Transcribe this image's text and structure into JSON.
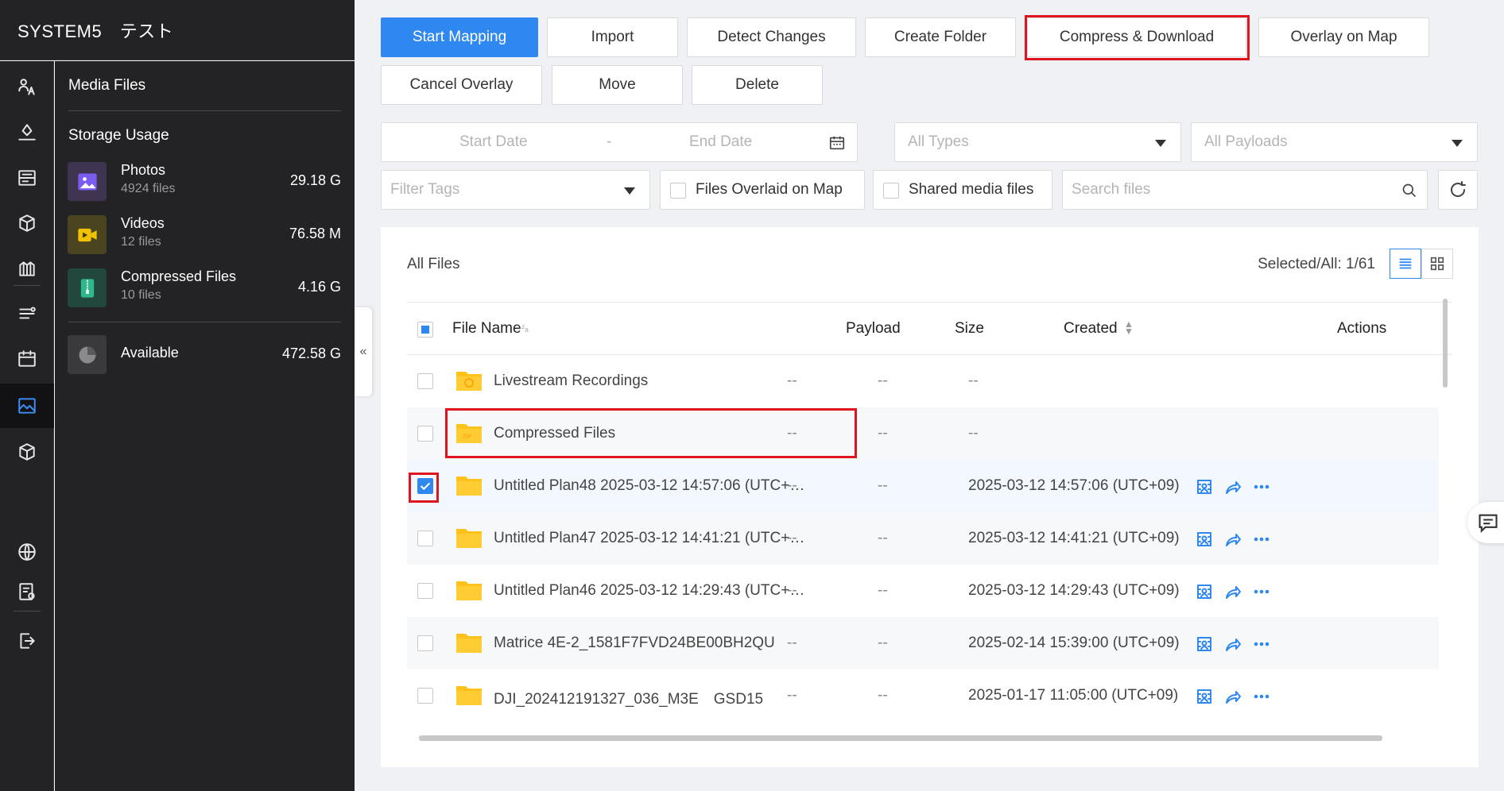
{
  "app": {
    "title": "SYSTEM5　テスト"
  },
  "panel": {
    "title": "Media Files",
    "storage_title": "Storage Usage",
    "items": [
      {
        "name": "Photos",
        "count": "4924 files",
        "size": "29.18 G",
        "color": "#6b4fd8"
      },
      {
        "name": "Videos",
        "count": "12 files",
        "size": "76.58 M",
        "color": "#f2c200"
      },
      {
        "name": "Compressed Files",
        "count": "10 files",
        "size": "4.16 G",
        "color": "#2fb88a"
      }
    ],
    "available": {
      "name": "Available",
      "size": "472.58 G"
    }
  },
  "rail_icons": [
    "team-icon",
    "flight-icon",
    "mission-icon",
    "model-icon",
    "map-layers-icon",
    "fleet-icon",
    "calendar-icon",
    "media-icon",
    "device-icon",
    "globe-icon",
    "settings-icon",
    "logout-icon"
  ],
  "toolbar": {
    "start_mapping": "Start Mapping",
    "import": "Import",
    "detect_changes": "Detect Changes",
    "create_folder": "Create Folder",
    "compress_download": "Compress & Download",
    "overlay_on_map": "Overlay on Map",
    "cancel_overlay": "Cancel Overlay",
    "move": "Move",
    "delete": "Delete"
  },
  "filters": {
    "start_date": "Start Date",
    "date_sep": "-",
    "end_date": "End Date",
    "types": "All Types",
    "payloads": "All Payloads",
    "tags": "Filter Tags",
    "overlaid": "Files Overlaid on Map",
    "shared": "Shared media files",
    "search_placeholder": "Search files"
  },
  "table": {
    "heading": "All Files",
    "selected": "Selected/All: 1/61",
    "columns": [
      "File Name",
      "Payload",
      "Size",
      "Created",
      "Actions"
    ],
    "rows": [
      {
        "name": "Livestream Recordings",
        "payload": "--",
        "size": "--",
        "created": "--",
        "checked": false,
        "folder": "live",
        "actions": false
      },
      {
        "name": "Compressed Files",
        "payload": "--",
        "size": "--",
        "created": "--",
        "checked": false,
        "folder": "zip",
        "actions": false
      },
      {
        "name": "Untitled Plan48 2025-03-12 14:57:06 (UTC+…",
        "payload": "--",
        "size": "--",
        "created": "2025-03-12 14:57:06 (UTC+09)",
        "checked": true,
        "folder": "plain",
        "actions": true
      },
      {
        "name": "Untitled Plan47 2025-03-12 14:41:21 (UTC+…",
        "payload": "--",
        "size": "--",
        "created": "2025-03-12 14:41:21 (UTC+09)",
        "checked": false,
        "folder": "plain",
        "actions": true
      },
      {
        "name": "Untitled Plan46 2025-03-12 14:29:43 (UTC+…",
        "payload": "--",
        "size": "--",
        "created": "2025-03-12 14:29:43 (UTC+09)",
        "checked": false,
        "folder": "plain",
        "actions": true
      },
      {
        "name": "Matrice 4E-2_1581F7FVD24BE00BH2QU",
        "payload": "--",
        "size": "--",
        "created": "2025-02-14 15:39:00 (UTC+09)",
        "checked": false,
        "folder": "plain",
        "actions": true
      },
      {
        "name": "DJI_202412191327_036_M3E　GSD15",
        "payload": "--",
        "size": "--",
        "created": "2025-01-17 11:05:00 (UTC+09)",
        "checked": false,
        "folder": "plain",
        "actions": true
      }
    ]
  },
  "colors": {
    "accent": "#2f87f0",
    "highlight": "#e0141e",
    "folder": "#ffc21a"
  }
}
